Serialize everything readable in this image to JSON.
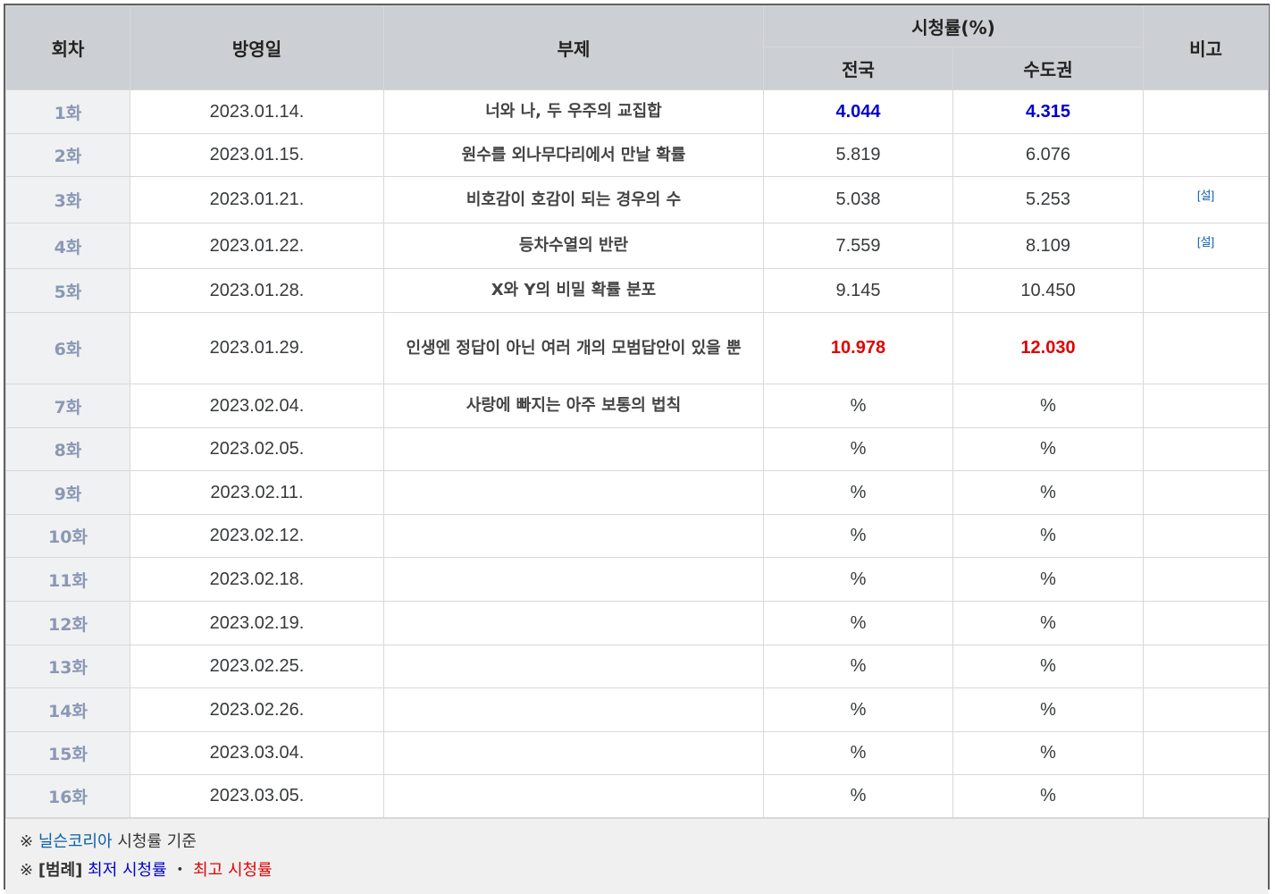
{
  "header": {
    "episode": "회차",
    "airdate": "방영일",
    "subtitle": "부제",
    "ratings": "시청률(%)",
    "nationwide": "전국",
    "capital": "수도권",
    "note": "비고"
  },
  "rows": [
    {
      "ep": "1화",
      "date": "2023.01.14.",
      "subtitle": "너와 나, 두 우주의 교집합",
      "nat": "4.044",
      "cap": "4.315",
      "note": ""
    },
    {
      "ep": "2화",
      "date": "2023.01.15.",
      "subtitle": "원수를 외나무다리에서 만날 확률",
      "nat": "5.819",
      "cap": "6.076",
      "note": ""
    },
    {
      "ep": "3화",
      "date": "2023.01.21.",
      "subtitle": "비호감이 호감이 되는 경우의 수",
      "nat": "5.038",
      "cap": "5.253",
      "note": "[설]"
    },
    {
      "ep": "4화",
      "date": "2023.01.22.",
      "subtitle": "등차수열의 반란",
      "nat": "7.559",
      "cap": "8.109",
      "note": "[설]"
    },
    {
      "ep": "5화",
      "date": "2023.01.28.",
      "subtitle": "X와 Y의 비밀 확률 분포",
      "nat": "9.145",
      "cap": "10.450",
      "note": ""
    },
    {
      "ep": "6화",
      "date": "2023.01.29.",
      "subtitle": "인생엔 정답이 아닌 여러 개의 모범답안이 있을 뿐",
      "nat": "10.978",
      "cap": "12.030",
      "note": ""
    },
    {
      "ep": "7화",
      "date": "2023.02.04.",
      "subtitle": "사랑에 빠지는 아주 보통의 법칙",
      "nat": "%",
      "cap": "%",
      "note": ""
    },
    {
      "ep": "8화",
      "date": "2023.02.05.",
      "subtitle": "",
      "nat": "%",
      "cap": "%",
      "note": ""
    },
    {
      "ep": "9화",
      "date": "2023.02.11.",
      "subtitle": "",
      "nat": "%",
      "cap": "%",
      "note": ""
    },
    {
      "ep": "10화",
      "date": "2023.02.12.",
      "subtitle": "",
      "nat": "%",
      "cap": "%",
      "note": ""
    },
    {
      "ep": "11화",
      "date": "2023.02.18.",
      "subtitle": "",
      "nat": "%",
      "cap": "%",
      "note": ""
    },
    {
      "ep": "12화",
      "date": "2023.02.19.",
      "subtitle": "",
      "nat": "%",
      "cap": "%",
      "note": ""
    },
    {
      "ep": "13화",
      "date": "2023.02.25.",
      "subtitle": "",
      "nat": "%",
      "cap": "%",
      "note": ""
    },
    {
      "ep": "14화",
      "date": "2023.02.26.",
      "subtitle": "",
      "nat": "%",
      "cap": "%",
      "note": ""
    },
    {
      "ep": "15화",
      "date": "2023.03.04.",
      "subtitle": "",
      "nat": "%",
      "cap": "%",
      "note": ""
    },
    {
      "ep": "16화",
      "date": "2023.03.05.",
      "subtitle": "",
      "nat": "%",
      "cap": "%",
      "note": ""
    }
  ],
  "footer": {
    "mark": "※",
    "source_link": "닐슨코리아",
    "source_text": " 시청률 기준",
    "legend_label": "[범례]",
    "lowest": "최저 시청률",
    "separator": "・",
    "highest": "최고 시청률"
  },
  "colors": {
    "lowest": "#0000cc",
    "highest": "#e00000",
    "header_bg": "#cccfd3"
  }
}
